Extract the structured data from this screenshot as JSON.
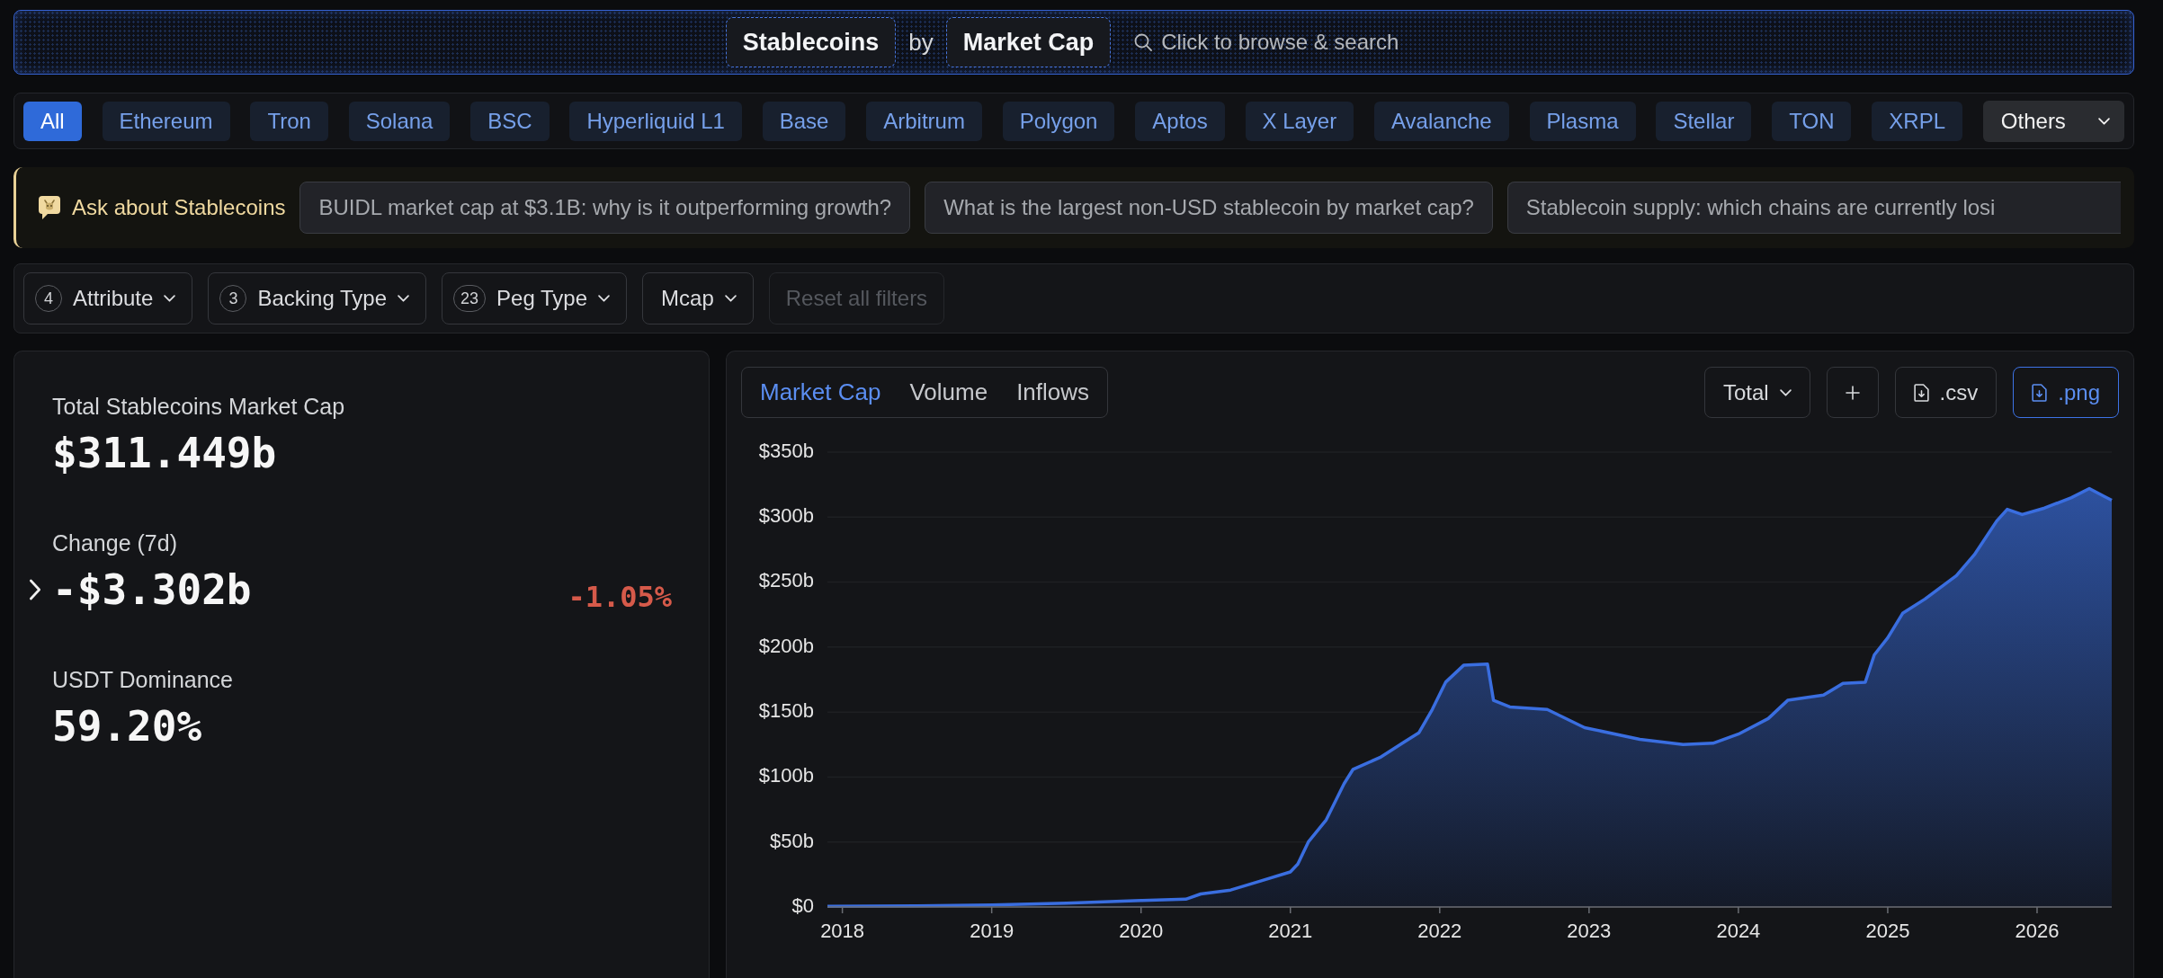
{
  "header": {
    "category": "Stablecoins",
    "connector": "by",
    "metric": "Market Cap",
    "search": {
      "placeholder": "Click to browse & search"
    }
  },
  "chain_tabs": [
    {
      "label": "All",
      "selected": true
    },
    {
      "label": "Ethereum",
      "selected": false
    },
    {
      "label": "Tron",
      "selected": false
    },
    {
      "label": "Solana",
      "selected": false
    },
    {
      "label": "BSC",
      "selected": false
    },
    {
      "label": "Hyperliquid L1",
      "selected": false
    },
    {
      "label": "Base",
      "selected": false
    },
    {
      "label": "Arbitrum",
      "selected": false
    },
    {
      "label": "Polygon",
      "selected": false
    },
    {
      "label": "Aptos",
      "selected": false
    },
    {
      "label": "X Layer",
      "selected": false
    },
    {
      "label": "Avalanche",
      "selected": false
    },
    {
      "label": "Plasma",
      "selected": false
    },
    {
      "label": "Stellar",
      "selected": false
    },
    {
      "label": "TON",
      "selected": false
    },
    {
      "label": "XRPL",
      "selected": false
    }
  ],
  "more_chains": {
    "label": "Others"
  },
  "ask_bar": {
    "title": "Ask about Stablecoins",
    "questions": [
      "BUIDL market cap at $3.1B: why is it outperforming growth?",
      "What is the largest non-USD stablecoin by market cap?",
      "Stablecoin supply: which chains are currently losi"
    ]
  },
  "filters": [
    {
      "kind": "dropdown",
      "count": "4",
      "label": "Attribute",
      "disabled": false
    },
    {
      "kind": "dropdown",
      "count": "3",
      "label": "Backing Type",
      "disabled": false
    },
    {
      "kind": "dropdown",
      "count": "23",
      "label": "Peg Type",
      "disabled": false
    },
    {
      "kind": "dropdown",
      "label": "Mcap",
      "disabled": false
    },
    {
      "kind": "reset",
      "label": "Reset all filters",
      "disabled": true
    }
  ],
  "stats": [
    {
      "kind": "plain",
      "label": "Total Stablecoins Market Cap",
      "value": "$311.449b"
    },
    {
      "kind": "change",
      "label": "Change (7d)",
      "value": "-$3.302b",
      "percent": "-1.05%",
      "negative": true,
      "expanded": false
    },
    {
      "kind": "plain",
      "label": "USDT Dominance",
      "value": "59.20%"
    }
  ],
  "chart_panel": {
    "tabs": [
      {
        "label": "Market Cap",
        "selected": true
      },
      {
        "label": "Volume",
        "selected": false
      },
      {
        "label": "Inflows",
        "selected": false
      }
    ],
    "series_select": {
      "label": "Total"
    },
    "downloads": [
      {
        "label": ".csv",
        "active": false
      },
      {
        "label": ".png",
        "active": true
      }
    ],
    "chart_data": {
      "type": "area",
      "grid": true,
      "x": [
        2017.9,
        2018.5,
        2019.0,
        2019.5,
        2020.0,
        2020.3,
        2020.4,
        2020.6,
        2020.8,
        2021.0,
        2021.05,
        2021.12,
        2021.24,
        2021.36,
        2021.42,
        2021.6,
        2021.75,
        2021.86,
        2021.95,
        2022.04,
        2022.16,
        2022.32,
        2022.36,
        2022.47,
        2022.72,
        2022.97,
        2023.34,
        2023.63,
        2023.83,
        2024.0,
        2024.2,
        2024.33,
        2024.57,
        2024.7,
        2024.85,
        2024.91,
        2025.0,
        2025.1,
        2025.25,
        2025.46,
        2025.58,
        2025.73,
        2025.8,
        2025.9,
        2026.05,
        2026.23,
        2026.35,
        2026.45,
        2026.5
      ],
      "values": [
        0.5,
        0.8,
        1.5,
        3,
        5,
        6,
        10,
        13,
        20,
        27,
        33,
        50,
        67,
        95,
        106,
        115,
        126,
        134,
        152,
        173,
        186,
        187,
        159,
        154,
        152,
        138,
        129,
        125,
        126,
        133,
        145,
        159,
        163,
        172,
        173,
        194,
        207,
        226,
        237,
        255,
        271,
        297,
        306,
        302,
        307,
        315,
        322,
        316,
        313
      ],
      "xlim": [
        2017.9,
        2026.5
      ],
      "ylim": [
        0,
        350
      ],
      "xticks": [
        2018,
        2019,
        2020,
        2021,
        2022,
        2023,
        2024,
        2025,
        2026
      ],
      "yticks": [
        {
          "value": 0,
          "label": "$0"
        },
        {
          "value": 50,
          "label": "$50b"
        },
        {
          "value": 100,
          "label": "$100b"
        },
        {
          "value": 150,
          "label": "$150b"
        },
        {
          "value": 200,
          "label": "$200b"
        },
        {
          "value": 250,
          "label": "$250b"
        },
        {
          "value": 300,
          "label": "$300b"
        },
        {
          "value": 350,
          "label": "$350b"
        }
      ]
    }
  }
}
